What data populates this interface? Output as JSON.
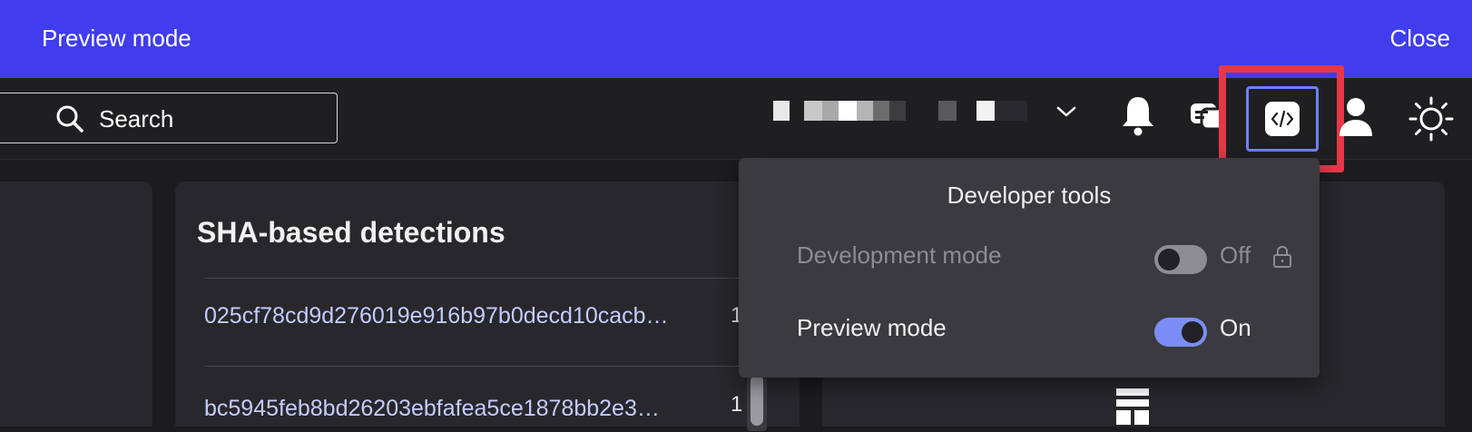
{
  "banner": {
    "title": "Preview mode",
    "close_label": "Close",
    "color": "#3f3ded"
  },
  "topbar": {
    "search_label": "Search",
    "icons": [
      "search-icon",
      "chevron-down-icon",
      "bell-icon",
      "chat-icon",
      "code-icon",
      "user-icon",
      "sun-icon"
    ]
  },
  "detections": {
    "title": "SHA-based detections",
    "rows": [
      {
        "hash": "025cf78cd9d276019e916b97b0decd10cacb…",
        "count": "1"
      },
      {
        "hash": "bc5945feb8bd26203ebfafea5ce1878bb2e3…",
        "count": "1"
      }
    ]
  },
  "developer_tools": {
    "title": "Developer tools",
    "settings": [
      {
        "label": "Development mode",
        "state": "Off",
        "enabled": false,
        "locked": true
      },
      {
        "label": "Preview mode",
        "state": "On",
        "enabled": true,
        "locked": false
      }
    ],
    "accent": "#7b8ef7",
    "highlight": "#e53848"
  }
}
